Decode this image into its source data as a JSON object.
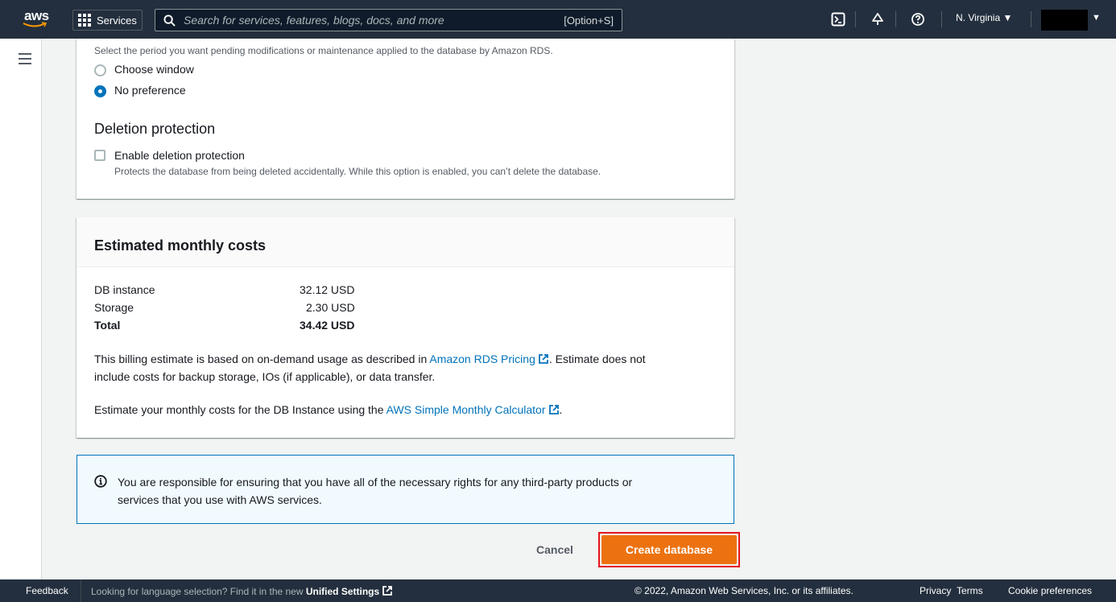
{
  "nav": {
    "logo_text": "aws",
    "services_label": "Services",
    "search_placeholder": "Search for services, features, blogs, docs, and more",
    "search_shortcut": "[Option+S]",
    "region": "N. Virginia ▼",
    "account_caret": "▼"
  },
  "maintenance": {
    "description": "Select the period you want pending modifications or maintenance applied to the database by Amazon RDS.",
    "options": [
      "Choose window",
      "No preference"
    ],
    "selected": "No preference"
  },
  "deletion": {
    "heading": "Deletion protection",
    "checkbox_label": "Enable deletion protection",
    "checked": false,
    "help": "Protects the database from being deleted accidentally. While this option is enabled, you can’t delete the database."
  },
  "costs": {
    "heading": "Estimated monthly costs",
    "rows": [
      {
        "label": "DB instance",
        "value": "32.12 USD"
      },
      {
        "label": "Storage",
        "value": "2.30 USD"
      },
      {
        "label": "Total",
        "value": "34.42 USD"
      }
    ],
    "billing_pre": "This billing estimate is based on on-demand usage as described in ",
    "billing_link": "Amazon RDS Pricing",
    "billing_post1": ". Estimate does not",
    "billing_line2": "include costs for backup storage, IOs (if applicable), or data transfer.",
    "calc_pre": "Estimate your monthly costs for the DB Instance using the ",
    "calc_link": "AWS Simple Monthly Calculator",
    "calc_post": "."
  },
  "alert": {
    "line1": "You are responsible for ensuring that you have all of the necessary rights for any third-party products or",
    "line2": "services that you use with AWS services."
  },
  "actions": {
    "cancel": "Cancel",
    "create": "Create database"
  },
  "footer": {
    "feedback": "Feedback",
    "lang_text": "Looking for language selection? Find it in the new ",
    "unified_settings": "Unified Settings",
    "copyright": "© 2022, Amazon Web Services, Inc. or its affiliates.",
    "privacy": "Privacy",
    "terms": "Terms",
    "cookies": "Cookie preferences"
  },
  "colors": {
    "nav_bg": "#232f3e",
    "primary_button": "#ec7211",
    "link": "#0073bb",
    "highlight_outline": "#e4151d"
  }
}
